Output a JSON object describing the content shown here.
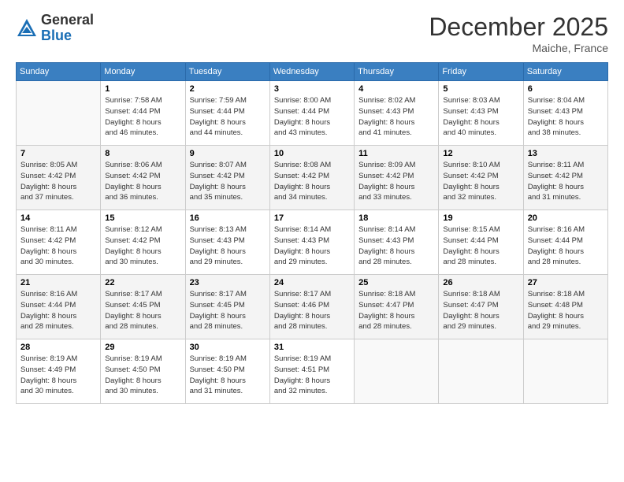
{
  "logo": {
    "general": "General",
    "blue": "Blue"
  },
  "header": {
    "month": "December 2025",
    "location": "Maiche, France"
  },
  "weekdays": [
    "Sunday",
    "Monday",
    "Tuesday",
    "Wednesday",
    "Thursday",
    "Friday",
    "Saturday"
  ],
  "weeks": [
    [
      {
        "day": "",
        "sunrise": "",
        "sunset": "",
        "daylight": ""
      },
      {
        "day": "1",
        "sunrise": "7:58 AM",
        "sunset": "4:44 PM",
        "daylight": "8 hours and 46 minutes."
      },
      {
        "day": "2",
        "sunrise": "7:59 AM",
        "sunset": "4:44 PM",
        "daylight": "8 hours and 44 minutes."
      },
      {
        "day": "3",
        "sunrise": "8:00 AM",
        "sunset": "4:44 PM",
        "daylight": "8 hours and 43 minutes."
      },
      {
        "day": "4",
        "sunrise": "8:02 AM",
        "sunset": "4:43 PM",
        "daylight": "8 hours and 41 minutes."
      },
      {
        "day": "5",
        "sunrise": "8:03 AM",
        "sunset": "4:43 PM",
        "daylight": "8 hours and 40 minutes."
      },
      {
        "day": "6",
        "sunrise": "8:04 AM",
        "sunset": "4:43 PM",
        "daylight": "8 hours and 38 minutes."
      }
    ],
    [
      {
        "day": "7",
        "sunrise": "8:05 AM",
        "sunset": "4:42 PM",
        "daylight": "8 hours and 37 minutes."
      },
      {
        "day": "8",
        "sunrise": "8:06 AM",
        "sunset": "4:42 PM",
        "daylight": "8 hours and 36 minutes."
      },
      {
        "day": "9",
        "sunrise": "8:07 AM",
        "sunset": "4:42 PM",
        "daylight": "8 hours and 35 minutes."
      },
      {
        "day": "10",
        "sunrise": "8:08 AM",
        "sunset": "4:42 PM",
        "daylight": "8 hours and 34 minutes."
      },
      {
        "day": "11",
        "sunrise": "8:09 AM",
        "sunset": "4:42 PM",
        "daylight": "8 hours and 33 minutes."
      },
      {
        "day": "12",
        "sunrise": "8:10 AM",
        "sunset": "4:42 PM",
        "daylight": "8 hours and 32 minutes."
      },
      {
        "day": "13",
        "sunrise": "8:11 AM",
        "sunset": "4:42 PM",
        "daylight": "8 hours and 31 minutes."
      }
    ],
    [
      {
        "day": "14",
        "sunrise": "8:11 AM",
        "sunset": "4:42 PM",
        "daylight": "8 hours and 30 minutes."
      },
      {
        "day": "15",
        "sunrise": "8:12 AM",
        "sunset": "4:42 PM",
        "daylight": "8 hours and 30 minutes."
      },
      {
        "day": "16",
        "sunrise": "8:13 AM",
        "sunset": "4:43 PM",
        "daylight": "8 hours and 29 minutes."
      },
      {
        "day": "17",
        "sunrise": "8:14 AM",
        "sunset": "4:43 PM",
        "daylight": "8 hours and 29 minutes."
      },
      {
        "day": "18",
        "sunrise": "8:14 AM",
        "sunset": "4:43 PM",
        "daylight": "8 hours and 28 minutes."
      },
      {
        "day": "19",
        "sunrise": "8:15 AM",
        "sunset": "4:44 PM",
        "daylight": "8 hours and 28 minutes."
      },
      {
        "day": "20",
        "sunrise": "8:16 AM",
        "sunset": "4:44 PM",
        "daylight": "8 hours and 28 minutes."
      }
    ],
    [
      {
        "day": "21",
        "sunrise": "8:16 AM",
        "sunset": "4:44 PM",
        "daylight": "8 hours and 28 minutes."
      },
      {
        "day": "22",
        "sunrise": "8:17 AM",
        "sunset": "4:45 PM",
        "daylight": "8 hours and 28 minutes."
      },
      {
        "day": "23",
        "sunrise": "8:17 AM",
        "sunset": "4:45 PM",
        "daylight": "8 hours and 28 minutes."
      },
      {
        "day": "24",
        "sunrise": "8:17 AM",
        "sunset": "4:46 PM",
        "daylight": "8 hours and 28 minutes."
      },
      {
        "day": "25",
        "sunrise": "8:18 AM",
        "sunset": "4:47 PM",
        "daylight": "8 hours and 28 minutes."
      },
      {
        "day": "26",
        "sunrise": "8:18 AM",
        "sunset": "4:47 PM",
        "daylight": "8 hours and 29 minutes."
      },
      {
        "day": "27",
        "sunrise": "8:18 AM",
        "sunset": "4:48 PM",
        "daylight": "8 hours and 29 minutes."
      }
    ],
    [
      {
        "day": "28",
        "sunrise": "8:19 AM",
        "sunset": "4:49 PM",
        "daylight": "8 hours and 30 minutes."
      },
      {
        "day": "29",
        "sunrise": "8:19 AM",
        "sunset": "4:50 PM",
        "daylight": "8 hours and 30 minutes."
      },
      {
        "day": "30",
        "sunrise": "8:19 AM",
        "sunset": "4:50 PM",
        "daylight": "8 hours and 31 minutes."
      },
      {
        "day": "31",
        "sunrise": "8:19 AM",
        "sunset": "4:51 PM",
        "daylight": "8 hours and 32 minutes."
      },
      {
        "day": "",
        "sunrise": "",
        "sunset": "",
        "daylight": ""
      },
      {
        "day": "",
        "sunrise": "",
        "sunset": "",
        "daylight": ""
      },
      {
        "day": "",
        "sunrise": "",
        "sunset": "",
        "daylight": ""
      }
    ]
  ],
  "labels": {
    "sunrise": "Sunrise:",
    "sunset": "Sunset:",
    "daylight": "Daylight:"
  }
}
